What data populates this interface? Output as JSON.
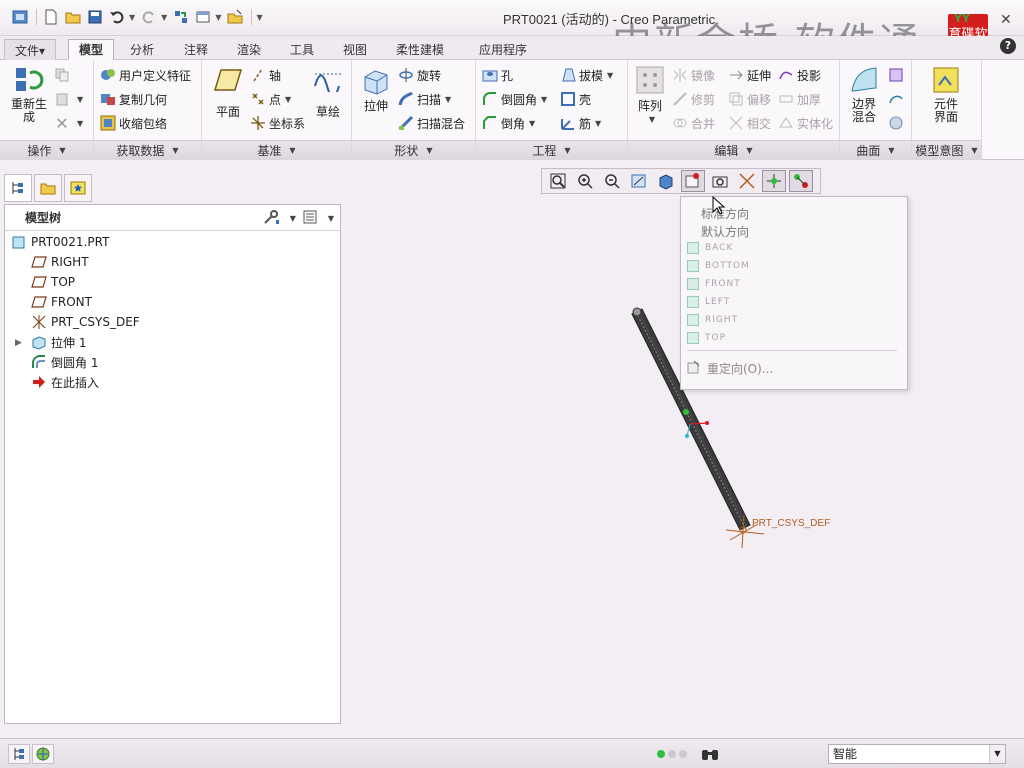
{
  "window": {
    "title": "PRT0021 (活动的) - Creo Parametric",
    "watermark": "中新金桥  软件通",
    "logo_text": "育碟软件",
    "logo_top": "YY"
  },
  "tabs": [
    {
      "label": "文件▾"
    },
    {
      "label": "模型"
    },
    {
      "label": "分析"
    },
    {
      "label": "注释"
    },
    {
      "label": "渲染"
    },
    {
      "label": "工具"
    },
    {
      "label": "视图"
    },
    {
      "label": "柔性建模"
    },
    {
      "label": "应用程序"
    }
  ],
  "ribbon": {
    "groups": {
      "operations": "操作",
      "get_data": "获取数据",
      "datum": "基准",
      "shapes": "形状",
      "engineering": "工程",
      "editing": "编辑",
      "surfaces": "曲面",
      "model_intent": "模型意图"
    },
    "regenerate": "重新生成",
    "udf": "用户定义特征",
    "copy_geom": "复制几何",
    "shrinkwrap": "收缩包络",
    "plane": "平面",
    "axis": "轴",
    "point": "点",
    "csys": "坐标系",
    "sketch": "草绘",
    "extrude": "拉伸",
    "revolve": "旋转",
    "sweep": "扫描",
    "swept_blend": "扫描混合",
    "hole": "孔",
    "round": "倒圆角",
    "chamfer": "倒角",
    "draft": "拔模",
    "shell": "壳",
    "rib": "筋",
    "pattern": "阵列",
    "mirror": "镜像",
    "extend": "延伸",
    "project": "投影",
    "trim": "修剪",
    "offset": "偏移",
    "thicken": "加厚",
    "merge": "合并",
    "intersect": "相交",
    "solidify": "实体化",
    "boundary_blend": "边界混合",
    "component_interface": "元件界面"
  },
  "model_tree": {
    "title": "模型树",
    "items": [
      {
        "label": "PRT0021.PRT"
      },
      {
        "label": "RIGHT"
      },
      {
        "label": "TOP"
      },
      {
        "label": "FRONT"
      },
      {
        "label": "PRT_CSYS_DEF"
      },
      {
        "label": "拉伸 1"
      },
      {
        "label": "倒圆角 1"
      },
      {
        "label": "在此插入"
      }
    ]
  },
  "view_menu": {
    "standard": "标准方向",
    "default": "默认方向",
    "views": [
      "BACK",
      "BOTTOM",
      "FRONT",
      "LEFT",
      "RIGHT",
      "TOP"
    ],
    "reorient": "重定向(O)..."
  },
  "graphics": {
    "csys_label": "PRT_CSYS_DEF"
  },
  "status": {
    "filter_value": "智能"
  },
  "colors": {
    "accent_red": "#d41e1e",
    "csys_orange": "#b15c1a",
    "status_green": "#2fbf3a"
  }
}
